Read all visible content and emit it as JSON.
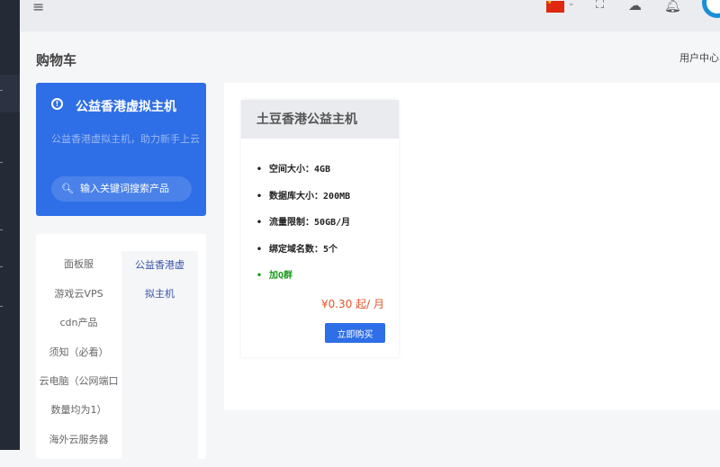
{
  "header": {
    "menu_icon": "≡",
    "flag": "china-flag",
    "icons": [
      "fullscreen-icon",
      "cloud-icon",
      "bell-icon"
    ]
  },
  "page": {
    "title": "购物车",
    "user_center": "用户中心"
  },
  "group": {
    "title": "公益香港虚拟主机",
    "description": "公益香港虚拟主机，助力新手上云",
    "search_placeholder": "输入关键词搜索产品"
  },
  "categories": [
    "面板服",
    "游戏云VPS",
    "cdn产品",
    "须知（必看）",
    "云电脑（公网端口数量均为1）",
    "海外云服务器"
  ],
  "active_category": "公益香港虚拟主机",
  "product": {
    "name": "土豆香港公益主机",
    "features": [
      "空间大小：4GB",
      "数据库大小：200MB",
      "流量限制：50GB/月",
      "绑定域名数：5个"
    ],
    "link": "加Q群",
    "price": "¥0.30 起/ 月",
    "buy_label": "立即购买"
  },
  "colors": {
    "accent": "#2e6ee6",
    "price": "#e0562a",
    "link": "#1a9a1a"
  }
}
